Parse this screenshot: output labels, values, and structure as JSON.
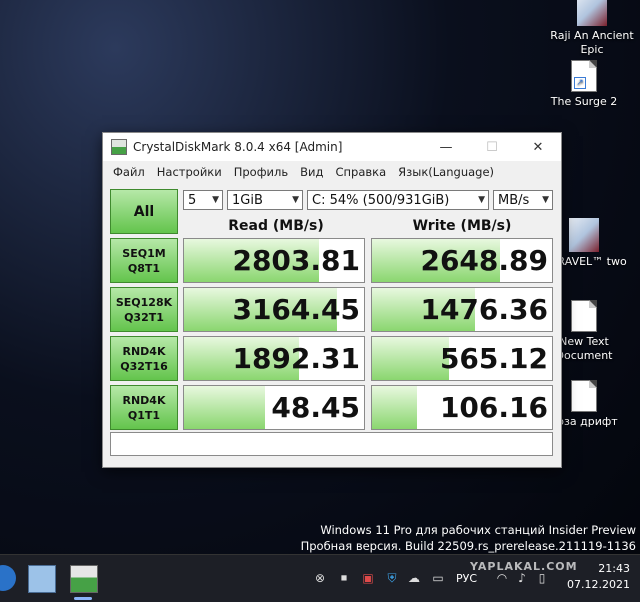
{
  "desktop_icons": [
    {
      "label": "Raji An Ancient Epic"
    },
    {
      "label": "The Surge 2"
    },
    {
      "label": "UNRAVEL™ two"
    },
    {
      "label": "New Text Document"
    },
    {
      "label": "орза дрифт"
    }
  ],
  "window": {
    "title": "CrystalDiskMark 8.0.4 x64 [Admin]",
    "menu": [
      "Файл",
      "Настройки",
      "Профиль",
      "Вид",
      "Справка",
      "Язык(Language)"
    ],
    "all_button": "All",
    "count": "5",
    "size": "1GiB",
    "drive": "C: 54% (500/931GiB)",
    "unit": "MB/s",
    "read_header": "Read (MB/s)",
    "write_header": "Write (MB/s)",
    "rows": [
      {
        "l1": "SEQ1M",
        "l2": "Q8T1",
        "read": "2803.81",
        "write": "2648.89",
        "read_fill": 0.75,
        "write_fill": 0.71
      },
      {
        "l1": "SEQ128K",
        "l2": "Q32T1",
        "read": "3164.45",
        "write": "1476.36",
        "read_fill": 0.85,
        "write_fill": 0.57
      },
      {
        "l1": "RND4K",
        "l2": "Q32T16",
        "read": "1892.31",
        "write": "565.12",
        "read_fill": 0.64,
        "write_fill": 0.43
      },
      {
        "l1": "RND4K",
        "l2": "Q1T1",
        "read": "48.45",
        "write": "106.16",
        "read_fill": 0.45,
        "write_fill": 0.25
      }
    ]
  },
  "watermark_text": {
    "line1": "Windows 11 Pro для рабочих станций Insider Preview",
    "line2": "Пробная версия. Build 22509.rs_prerelease.211119-1136"
  },
  "taskbar": {
    "lang": "РУС",
    "time": "21:43",
    "date": "07.12.2021",
    "site_mark": "YAPLAKAL.COM"
  },
  "colors": {
    "accent_green": "#63c44c",
    "bar_green": "#8ad66f"
  }
}
